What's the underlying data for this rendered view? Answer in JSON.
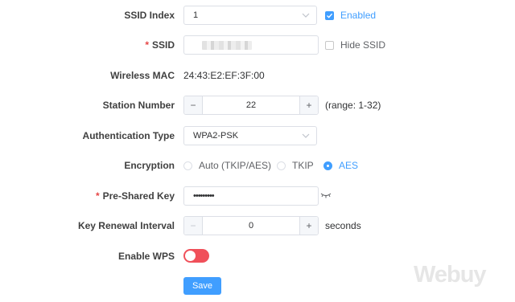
{
  "ssid_index": {
    "label": "SSID Index",
    "value": "1",
    "enabled_label": "Enabled",
    "enabled_checked": true
  },
  "ssid": {
    "label": "SSID",
    "required_mark": "*",
    "hide_label": "Hide SSID",
    "hide_checked": false
  },
  "wireless_mac": {
    "label": "Wireless MAC",
    "value": "24:43:E2:EF:3F:00"
  },
  "station_number": {
    "label": "Station Number",
    "value": "22",
    "minus": "−",
    "plus": "+",
    "range": "(range: 1-32)"
  },
  "authentication": {
    "label": "Authentication Type",
    "value": "WPA2-PSK"
  },
  "encryption": {
    "label": "Encryption",
    "options": [
      {
        "label": "Auto (TKIP/AES)",
        "selected": false
      },
      {
        "label": "TKIP",
        "selected": false
      },
      {
        "label": "AES",
        "selected": true
      }
    ]
  },
  "psk": {
    "label": "Pre-Shared Key",
    "required_mark": "*",
    "masked_value": "•••••••••"
  },
  "key_renewal": {
    "label": "Key Renewal Interval",
    "value": "0",
    "minus": "−",
    "plus": "+",
    "suffix": "seconds"
  },
  "wps": {
    "label": "Enable WPS",
    "on": false
  },
  "save_label": "Save",
  "watermark": "Webuy",
  "colors": {
    "accent": "#409eff",
    "toggle_off": "#f0505a",
    "required": "#e64545"
  }
}
